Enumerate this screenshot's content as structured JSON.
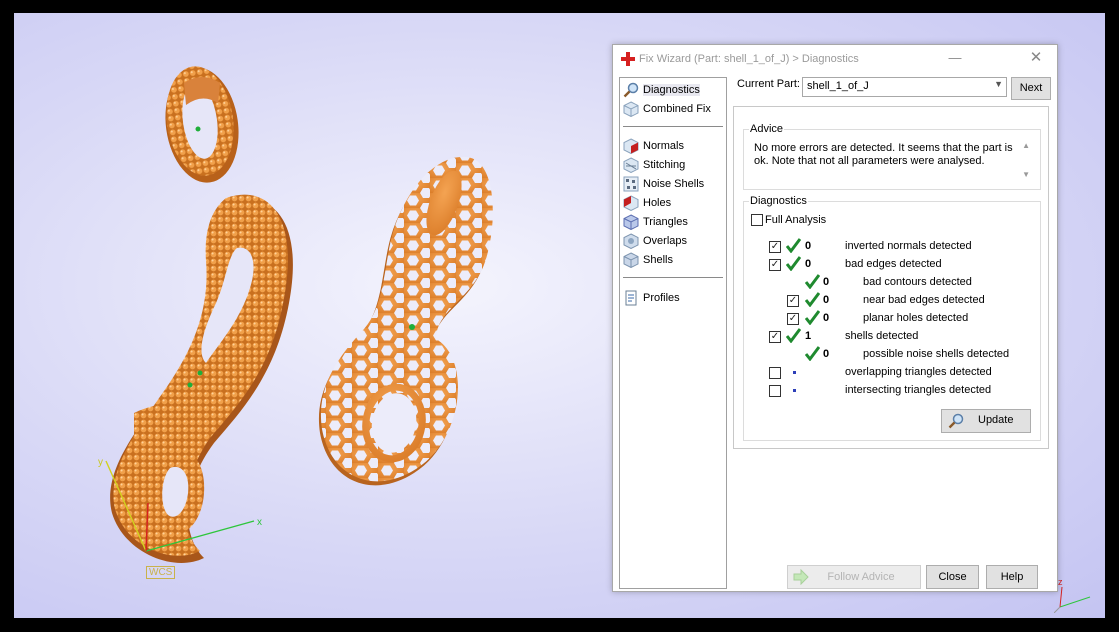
{
  "viewport": {
    "wcs_label": "WCS",
    "axis_x_label": "x",
    "axis_y_label": "y",
    "corner_axis_label": "z"
  },
  "dialog": {
    "title": "Fix Wizard (Part: shell_1_of_J) > Diagnostics",
    "minimize_glyph": "—",
    "close_glyph": "✕",
    "nav": {
      "group1": [
        {
          "label": "Diagnostics",
          "icon": "magnifier-icon",
          "selected": true
        },
        {
          "label": "Combined Fix",
          "icon": "cube-icon"
        }
      ],
      "group2": [
        {
          "label": "Normals",
          "icon": "normals-icon"
        },
        {
          "label": "Stitching",
          "icon": "stitching-icon"
        },
        {
          "label": "Noise Shells",
          "icon": "noise-shells-icon"
        },
        {
          "label": "Holes",
          "icon": "holes-icon"
        },
        {
          "label": "Triangles",
          "icon": "triangles-icon"
        },
        {
          "label": "Overlaps",
          "icon": "overlaps-icon"
        },
        {
          "label": "Shells",
          "icon": "shells-icon"
        }
      ],
      "group3": [
        {
          "label": "Profiles",
          "icon": "profiles-icon"
        }
      ]
    },
    "current_part_label": "Current Part:",
    "current_part_value": "shell_1_of_J",
    "next_label": "Next",
    "advice_title": "Advice",
    "advice_text": "No more errors are detected. It seems that the part is ok. Note that not all parameters were analysed.",
    "diagnostics_title": "Diagnostics",
    "full_analysis_label": "Full Analysis",
    "full_analysis_checked": false,
    "rows": [
      {
        "checked": true,
        "passed": true,
        "count": "0",
        "label": "inverted normals detected",
        "indent": 0
      },
      {
        "checked": true,
        "passed": true,
        "count": "0",
        "label": "bad edges detected",
        "indent": 0
      },
      {
        "checkbox": false,
        "passed": true,
        "count": "0",
        "label": "bad contours detected",
        "indent": 1
      },
      {
        "checked": true,
        "passed": true,
        "count": "0",
        "label": "near bad edges detected",
        "indent": 1
      },
      {
        "checked": true,
        "passed": true,
        "count": "0",
        "label": "planar holes detected",
        "indent": 1
      },
      {
        "checked": true,
        "passed": true,
        "count": "1",
        "label": "shells detected",
        "indent": 0
      },
      {
        "checkbox": false,
        "passed": true,
        "count": "0",
        "label": "possible noise shells detected",
        "indent": 1
      },
      {
        "checked": false,
        "passed": null,
        "count": "",
        "label": "overlapping triangles detected",
        "indent": 0
      },
      {
        "checked": false,
        "passed": null,
        "count": "",
        "label": "intersecting triangles detected",
        "indent": 0
      }
    ],
    "update_label": "Update",
    "follow_advice_label": "Follow Advice",
    "close_label": "Close",
    "help_label": "Help"
  },
  "colors": {
    "model_orange": "#e8892e",
    "check_green": "#1f8a2f",
    "accent_red": "#d62020"
  }
}
